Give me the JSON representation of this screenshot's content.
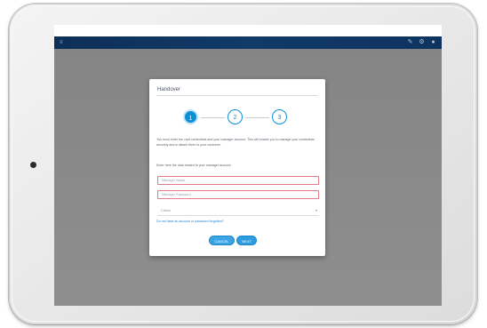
{
  "dialog": {
    "title": "Handover",
    "steps": [
      "1",
      "2",
      "3"
    ],
    "intro": "You must enter the card credentials and your manager account. This will enable you to manage your credentials securely and to attach them to your customer.",
    "prompt": "Enter here the data related to your manager account.",
    "username_placeholder": "Manager Name",
    "password_placeholder": "Manager Password",
    "select_value": "Check",
    "help_link": "Do not have an account or password forgotten?",
    "cancel_label": "CANCEL",
    "next_label": "NEXT"
  },
  "icons": {
    "menu": "menu-icon",
    "toolbar": [
      "edit-icon",
      "settings-icon",
      "user-icon"
    ]
  },
  "colors": {
    "topbar": "#113a69",
    "accent": "#0b8fd6",
    "error_border": "#e27a8a",
    "backdrop": "#8b8b8b"
  }
}
